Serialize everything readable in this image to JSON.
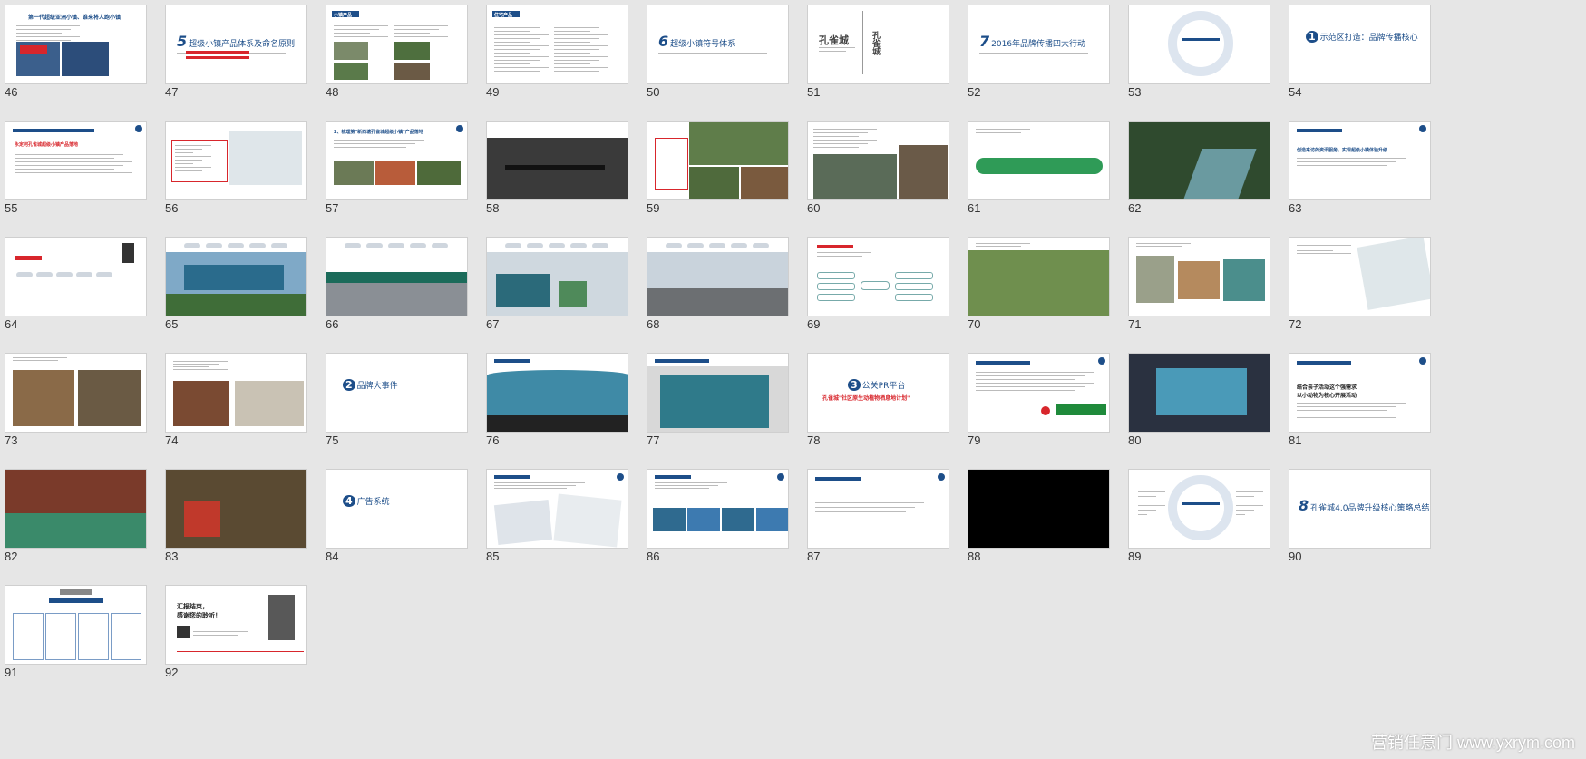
{
  "slides": [
    {
      "n": "46",
      "style": "article",
      "t1": "第一代超级亚洲小镇、谁来将人跑小镇"
    },
    {
      "n": "47",
      "style": "numbered",
      "digit": "5",
      "title": "超级小镇产品体系及命名原则"
    },
    {
      "n": "48",
      "style": "photos4",
      "t1": "小镇产品"
    },
    {
      "n": "49",
      "style": "lists",
      "t1": "住宅产品"
    },
    {
      "n": "50",
      "style": "numbered",
      "digit": "6",
      "title": "超级小镇符号体系"
    },
    {
      "n": "51",
      "style": "logo",
      "logo": "孔雀城"
    },
    {
      "n": "52",
      "style": "numbered",
      "digit": "7",
      "title": "2016年品牌传播四大行动"
    },
    {
      "n": "53",
      "style": "circle"
    },
    {
      "n": "54",
      "style": "heading",
      "digit": "1",
      "title": "示范区打造：品牌传播核心"
    },
    {
      "n": "55",
      "style": "text",
      "t1": "永定河孔雀城超级小镇产品落地"
    },
    {
      "n": "56",
      "style": "map"
    },
    {
      "n": "57",
      "style": "photos3",
      "t1": "2、梳理第\"新西塘孔雀城超级小镇\"产品落地"
    },
    {
      "n": "58",
      "style": "darkphoto"
    },
    {
      "n": "59",
      "style": "garden"
    },
    {
      "n": "60",
      "style": "waterphoto"
    },
    {
      "n": "61",
      "style": "greencurve"
    },
    {
      "n": "62",
      "style": "parkphoto"
    },
    {
      "n": "63",
      "style": "textblue",
      "t1": "创造来访的资讯服务，实现超级小镇体验升级"
    },
    {
      "n": "64",
      "style": "flow"
    },
    {
      "n": "65",
      "style": "billboard"
    },
    {
      "n": "66",
      "style": "gate"
    },
    {
      "n": "67",
      "style": "boards"
    },
    {
      "n": "68",
      "style": "road"
    },
    {
      "n": "69",
      "style": "mindmap"
    },
    {
      "n": "70",
      "style": "aerial"
    },
    {
      "n": "71",
      "style": "brochure"
    },
    {
      "n": "72",
      "style": "folder"
    },
    {
      "n": "73",
      "style": "houses"
    },
    {
      "n": "74",
      "style": "wall"
    },
    {
      "n": "75",
      "style": "heading",
      "digit": "2",
      "title": "品牌大事件"
    },
    {
      "n": "76",
      "style": "screen"
    },
    {
      "n": "77",
      "style": "stage"
    },
    {
      "n": "78",
      "style": "pr",
      "digit": "3",
      "title": "公关PR平台",
      "sub": "孔雀城\"社区原生动植物栖息地计划\""
    },
    {
      "n": "79",
      "style": "partners"
    },
    {
      "n": "80",
      "style": "event"
    },
    {
      "n": "81",
      "style": "textonly",
      "t1": "结合亲子活动这个强需求",
      "t2": "以小动物为核心开展活动"
    },
    {
      "n": "82",
      "style": "kids"
    },
    {
      "n": "83",
      "style": "child"
    },
    {
      "n": "84",
      "style": "heading",
      "digit": "4",
      "title": "广告系统"
    },
    {
      "n": "85",
      "style": "print"
    },
    {
      "n": "86",
      "style": "outdoor"
    },
    {
      "n": "87",
      "style": "plaintext"
    },
    {
      "n": "88",
      "style": "black"
    },
    {
      "n": "89",
      "style": "circle2"
    },
    {
      "n": "90",
      "style": "heading2",
      "digit": "8",
      "title": "孔雀城4.0品牌升级核心策略总结"
    },
    {
      "n": "91",
      "style": "org"
    },
    {
      "n": "92",
      "style": "end",
      "t1": "汇报结束，",
      "t2": "感谢您的聆听！"
    }
  ],
  "watermark": "营销任意门 www.yxrym.com"
}
